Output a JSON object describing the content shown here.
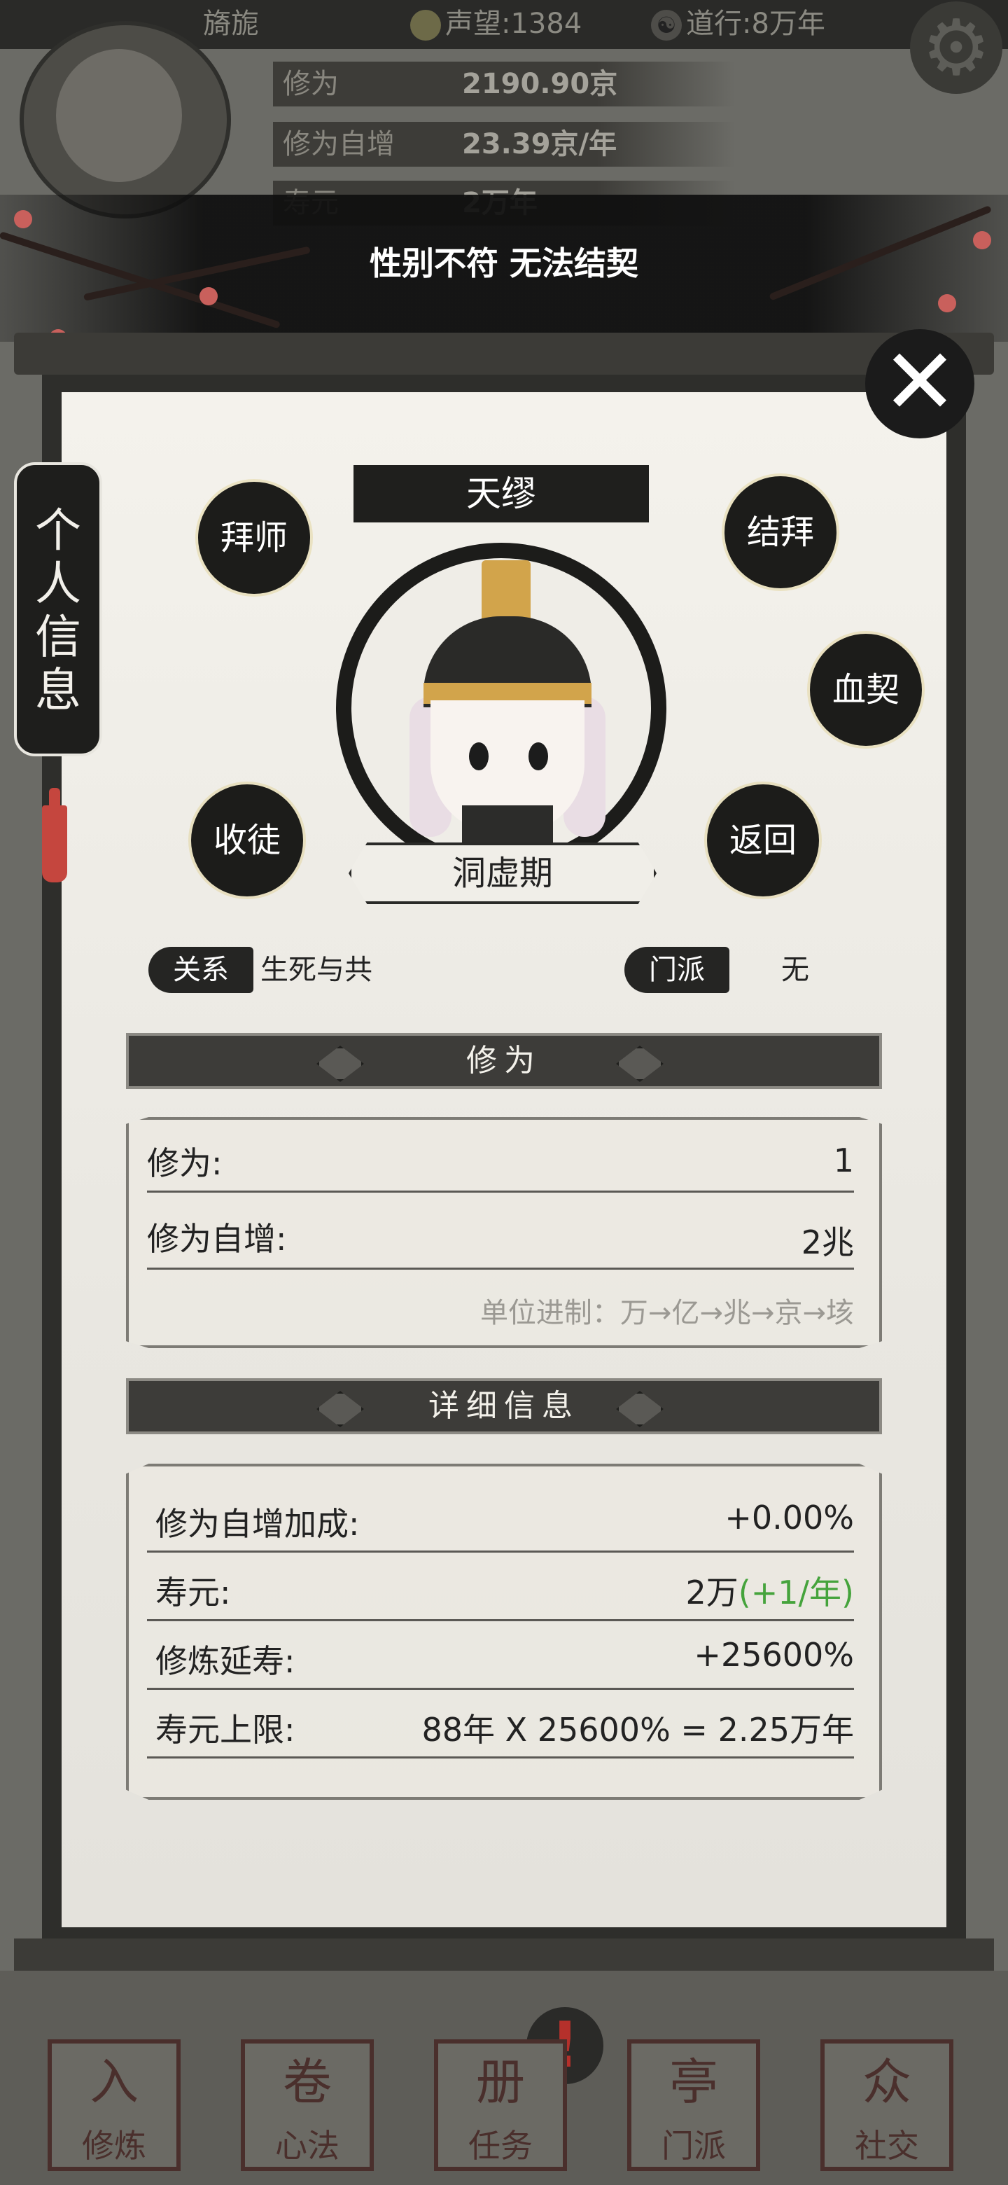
{
  "topbar": {
    "player_name": "旖旎",
    "reputation": "声望:1384",
    "dao": "道行:8万年",
    "dao_icon": "☯"
  },
  "background_panel": {
    "rows": [
      {
        "label": "修为",
        "value": "2190.90京"
      },
      {
        "label": "修为自增",
        "value": "23.39京/年"
      },
      {
        "label": "寿元",
        "value": "2万年"
      }
    ]
  },
  "toast": {
    "message": "性别不符 无法结契"
  },
  "side_tab": {
    "label": "个人信息"
  },
  "close": {
    "glyph": "✕"
  },
  "profile": {
    "name": "天缪",
    "realm": "洞虚期",
    "actions": {
      "master": "拜师",
      "sworn": "结拜",
      "blood_pact": "血契",
      "apprentice": "收徒",
      "back": "返回"
    },
    "relation_label": "关系",
    "relation_value": "生死与共",
    "sect_label": "门派",
    "sect_value": "无"
  },
  "cultivation": {
    "title": "修为",
    "rows": [
      {
        "label": "修为:",
        "value": "1"
      },
      {
        "label": "修为自增:",
        "value": "2兆"
      }
    ],
    "unit_hint": "单位进制：万→亿→兆→京→垓"
  },
  "details": {
    "title": "详细信息",
    "rows": [
      {
        "label": "修为自增加成:",
        "value": "+0.00%"
      },
      {
        "label": "寿元:",
        "value": "2万",
        "extra": "(+1/年)"
      },
      {
        "label": "修炼延寿:",
        "value": "+25600%"
      },
      {
        "label": "寿元上限:",
        "value": "88年 X 25600% = 2.25万年"
      }
    ]
  },
  "bottom_nav": {
    "alert": "!",
    "items": [
      {
        "label": "修炼",
        "icon": "入"
      },
      {
        "label": "心法",
        "icon": "卷"
      },
      {
        "label": "任务",
        "icon": "册"
      },
      {
        "label": "门派",
        "icon": "亭"
      },
      {
        "label": "社交",
        "icon": "众"
      }
    ]
  },
  "colors": {
    "accent_green": "#45a33c",
    "ink": "#1c1c1a",
    "paper": "#efede7",
    "tassel_red": "#c5463e"
  }
}
